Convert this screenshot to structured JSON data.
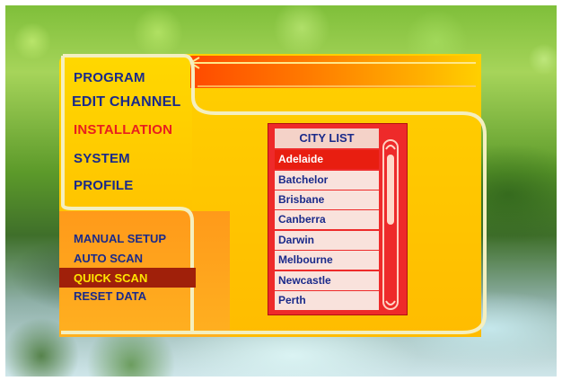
{
  "menu": {
    "items": [
      {
        "label": "PROGRAM",
        "active": false
      },
      {
        "label": "EDIT CHANNEL",
        "active": false
      },
      {
        "label": "INSTALLATION",
        "active": true
      },
      {
        "label": "SYSTEM",
        "active": false
      },
      {
        "label": "PROFILE",
        "active": false
      }
    ]
  },
  "submenu": {
    "items": [
      {
        "label": "MANUAL SETUP"
      },
      {
        "label": "AUTO SCAN"
      },
      {
        "label": "QUICK SCAN",
        "selected": true
      },
      {
        "label": "RESET DATA"
      }
    ]
  },
  "city_list": {
    "title": "CITY LIST",
    "cities": [
      "Adelaide",
      "Batchelor",
      "Brisbane",
      "Canberra",
      "Darwin",
      "Melbourne",
      "Newcastle",
      "Perth"
    ],
    "selected": "Adelaide"
  },
  "colors": {
    "panel_yellow": "#ffd000",
    "accent_red": "#e81e1e",
    "text_navy": "#1a2a8a",
    "highlight_yellow": "#ffe400"
  }
}
